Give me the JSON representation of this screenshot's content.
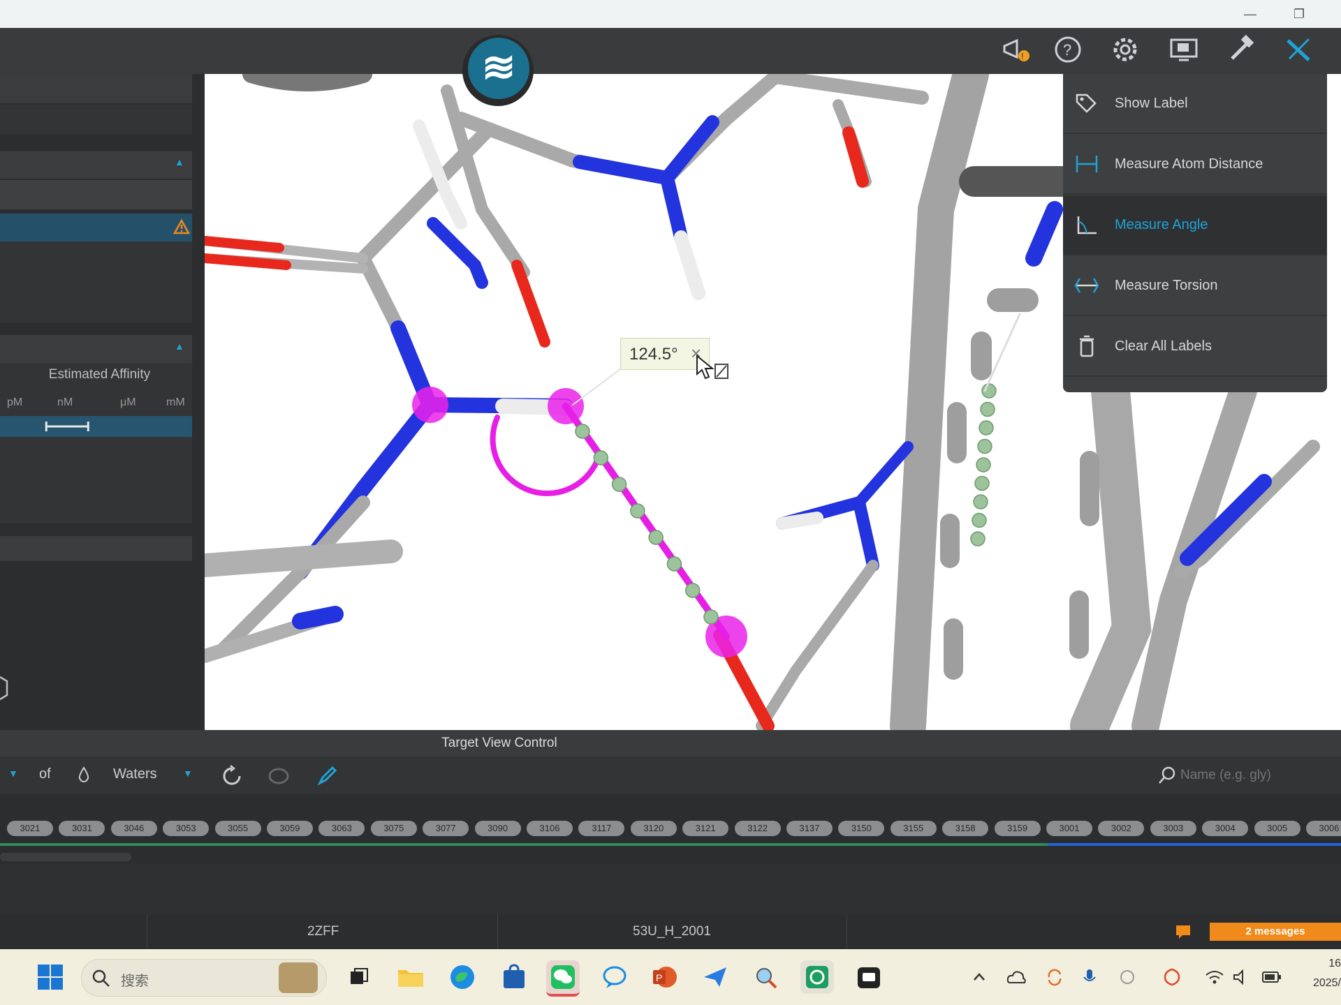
{
  "window": {
    "minimize_label": "—",
    "restore_label": "❐"
  },
  "app": {
    "logo_text": "≋"
  },
  "toolbar": {
    "icons": [
      "announcement-icon",
      "help-icon",
      "settings-icon",
      "display-icon",
      "build-tools-icon",
      "measure-tools-icon"
    ]
  },
  "left_panel": {
    "affinity_title": "Estimated Affinity",
    "affinity_scale": [
      "pM",
      "nM",
      "μM",
      "mM"
    ],
    "affinity_level": 0.35
  },
  "viewport": {
    "angle_label": "124.5°",
    "close_label": "×"
  },
  "tool_menu": {
    "items": [
      {
        "label": "Show Label",
        "icon": "tag-icon"
      },
      {
        "label": "Measure Atom Distance",
        "icon": "distance-icon"
      },
      {
        "label": "Measure Angle",
        "icon": "angle-icon",
        "active": true
      },
      {
        "label": "Measure Torsion",
        "icon": "torsion-icon"
      },
      {
        "label": "Clear All Labels",
        "icon": "trash-icon"
      }
    ]
  },
  "target_view_control": {
    "title": "Target View Control",
    "of_label": "of",
    "waters_label": "Waters",
    "search_placeholder": "Name (e.g. gly)"
  },
  "residues": [
    "3021",
    "3031",
    "3046",
    "3053",
    "3055",
    "3059",
    "3063",
    "3075",
    "3077",
    "3090",
    "3106",
    "3117",
    "3120",
    "3121",
    "3122",
    "3137",
    "3150",
    "3155",
    "3158",
    "3159",
    "3001",
    "3002",
    "3003",
    "3004",
    "3005",
    "3006"
  ],
  "status_bar": {
    "left": "2ZFF",
    "center": "53U_H_2001",
    "messages": "2 messages"
  },
  "taskbar": {
    "search_placeholder": "搜索",
    "clock_time": "16",
    "clock_date": "2025/"
  },
  "colors": {
    "accent": "#1fa3d6",
    "selection": "#e61ee6",
    "nitrogen": "#1a2be0",
    "oxygen": "#e8281c",
    "bond": "#a8a8a8",
    "hbond": "#9cc39c",
    "warning": "#f08a1a"
  }
}
